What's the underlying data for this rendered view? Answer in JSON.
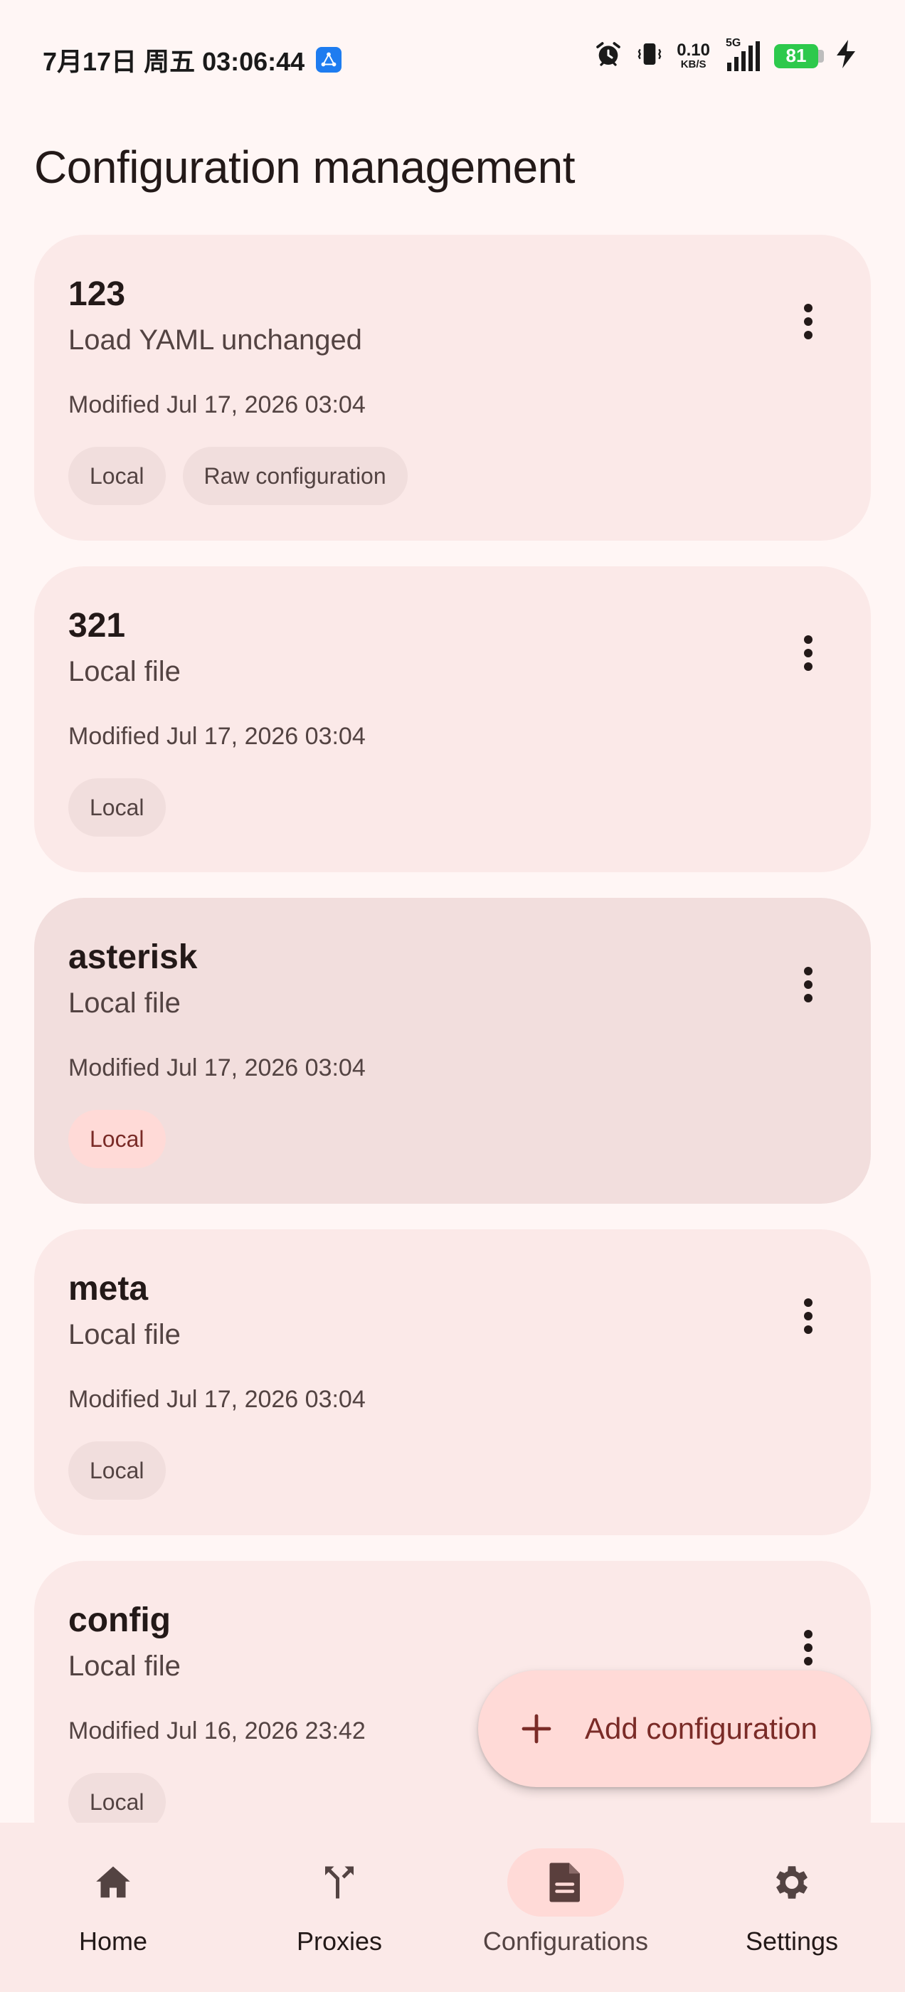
{
  "status_bar": {
    "datetime": "7月17日 周五 03:06:44",
    "net_speed_value": "0.10",
    "net_speed_unit": "KB/S",
    "network_type": "5G",
    "battery_level": "81"
  },
  "page": {
    "title": "Configuration management"
  },
  "configs": [
    {
      "name": "123",
      "description": "Load YAML unchanged",
      "modified": "Modified Jul 17, 2026 03:04",
      "chips": [
        "Local",
        "Raw configuration"
      ],
      "selected": false
    },
    {
      "name": "321",
      "description": "Local file",
      "modified": "Modified Jul 17, 2026 03:04",
      "chips": [
        "Local"
      ],
      "selected": false
    },
    {
      "name": "asterisk",
      "description": "Local file",
      "modified": "Modified Jul 17, 2026 03:04",
      "chips": [
        "Local"
      ],
      "selected": true
    },
    {
      "name": "meta",
      "description": "Local file",
      "modified": "Modified Jul 17, 2026 03:04",
      "chips": [
        "Local"
      ],
      "selected": false
    },
    {
      "name": "config",
      "description": "Local file",
      "modified": "Modified Jul 16, 2026 23:42",
      "chips": [
        "Local"
      ],
      "selected": false
    }
  ],
  "fab": {
    "label": "Add configuration",
    "icon": "plus-icon"
  },
  "bottom_nav": {
    "items": [
      {
        "label": "Home",
        "icon": "home-icon",
        "active": false
      },
      {
        "label": "Proxies",
        "icon": "fork-icon",
        "active": false
      },
      {
        "label": "Configurations",
        "icon": "document-icon",
        "active": true
      },
      {
        "label": "Settings",
        "icon": "gear-icon",
        "active": false
      }
    ]
  },
  "colors": {
    "background": "#fff6f5",
    "card": "#fbe9e8",
    "card_selected": "#f2dedd",
    "accent_container": "#ffdad7",
    "on_accent": "#7a2b27"
  }
}
